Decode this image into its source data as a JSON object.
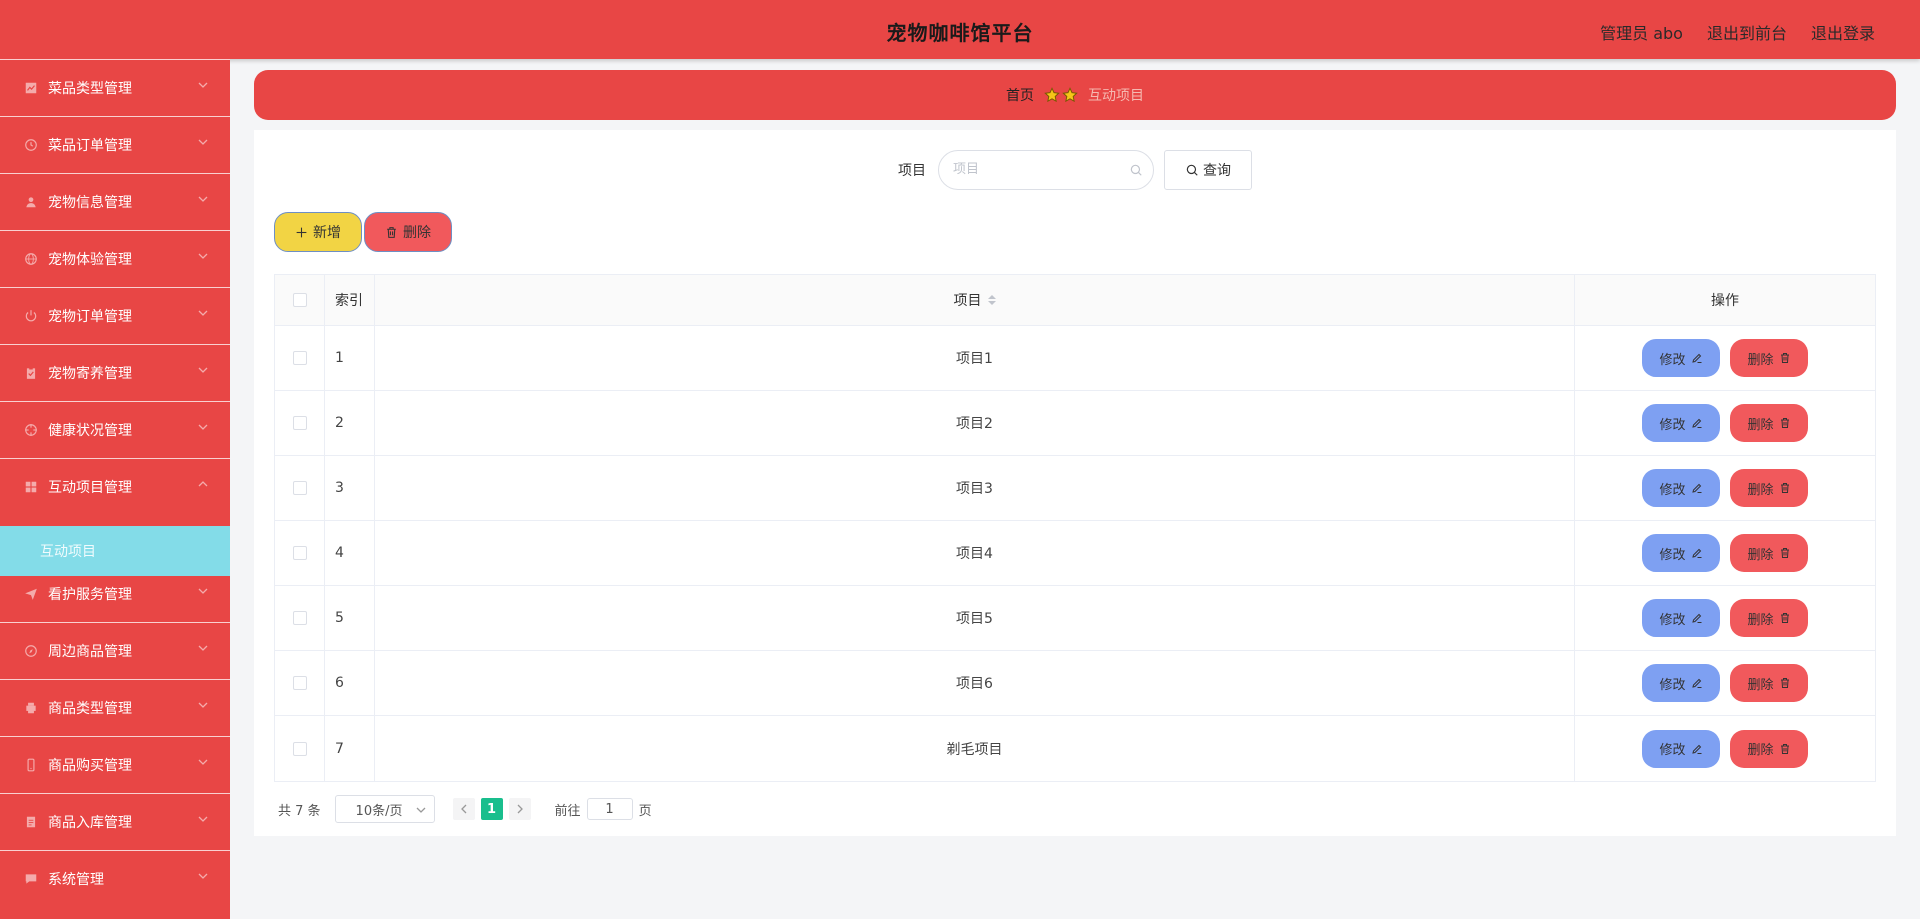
{
  "header": {
    "title": "宠物咖啡馆平台",
    "user": "管理员 abo",
    "to_front": "退出到前台",
    "logout": "退出登录"
  },
  "colors": {
    "primary": "#e84645",
    "submenu_active": "#83dce8",
    "add_button": "#f2d444",
    "delete_button": "#f1595c",
    "edit_button": "#7ea0f2",
    "page_active": "#19be8d"
  },
  "sidebar": {
    "items": [
      {
        "label": "菜品类型管理",
        "icon": "chart-icon"
      },
      {
        "label": "菜品订单管理",
        "icon": "clock-icon"
      },
      {
        "label": "宠物信息管理",
        "icon": "user-icon"
      },
      {
        "label": "宠物体验管理",
        "icon": "globe-icon"
      },
      {
        "label": "宠物订单管理",
        "icon": "power-icon"
      },
      {
        "label": "宠物寄养管理",
        "icon": "clipboard-icon"
      },
      {
        "label": "健康状况管理",
        "icon": "target-icon"
      },
      {
        "label": "互动项目管理",
        "icon": "grid-icon"
      },
      {
        "label": "看护服务管理",
        "icon": "send-icon"
      },
      {
        "label": "周边商品管理",
        "icon": "compass-icon"
      },
      {
        "label": "商品类型管理",
        "icon": "printer-icon"
      },
      {
        "label": "商品购买管理",
        "icon": "phone-icon"
      },
      {
        "label": "商品入库管理",
        "icon": "document-icon"
      },
      {
        "label": "系统管理",
        "icon": "chat-icon"
      }
    ],
    "active_sub": "互动项目"
  },
  "breadcrumb": {
    "home": "首页",
    "current": "互动项目"
  },
  "search": {
    "label": "项目",
    "placeholder": "项目",
    "value": "",
    "button": "查询"
  },
  "actions": {
    "add": "新增",
    "delete": "删除"
  },
  "table": {
    "columns": {
      "index": "索引",
      "item": "项目",
      "op": "操作"
    },
    "edit_label": "修改",
    "delete_label": "删除",
    "rows": [
      {
        "index": "1",
        "item": "项目1"
      },
      {
        "index": "2",
        "item": "项目2"
      },
      {
        "index": "3",
        "item": "项目3"
      },
      {
        "index": "4",
        "item": "项目4"
      },
      {
        "index": "5",
        "item": "项目5"
      },
      {
        "index": "6",
        "item": "项目6"
      },
      {
        "index": "7",
        "item": "剃毛项目"
      }
    ]
  },
  "pagination": {
    "total": "共 7 条",
    "page_size": "10条/页",
    "current": "1",
    "goto_prefix": "前往",
    "goto_value": "1",
    "goto_suffix": "页"
  }
}
